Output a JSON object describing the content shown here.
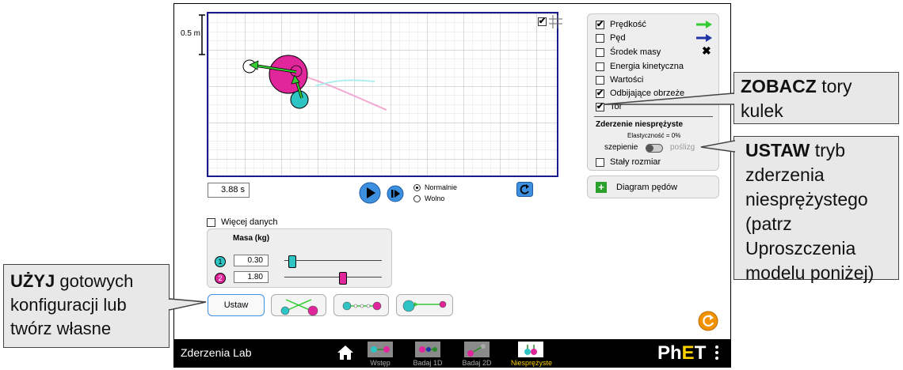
{
  "app": {
    "title": "Zderzenia Lab",
    "brand": "PhET"
  },
  "scale": {
    "label": "0.5 m"
  },
  "time": {
    "value": "3.88 s"
  },
  "speed_options": [
    {
      "label": "Normalnie",
      "selected": true
    },
    {
      "label": "Wolno",
      "selected": false
    }
  ],
  "options": [
    {
      "label": "Prędkość",
      "checked": true,
      "marker": "green-arrow"
    },
    {
      "label": "Pęd",
      "checked": false,
      "marker": "blue-arrow"
    },
    {
      "label": "Środek masy",
      "checked": false,
      "marker": "x-icon"
    },
    {
      "label": "Energia kinetyczna",
      "checked": false
    },
    {
      "label": "Wartości",
      "checked": false
    },
    {
      "label": "Odbijające obrzeże",
      "checked": true
    },
    {
      "label": "Tor",
      "checked": true
    }
  ],
  "collision": {
    "title": "Zderzenie niesprężyste",
    "elasticity": "Elastyczność = 0%",
    "left_label": "szepienie",
    "right_label": "poślizg",
    "stick": true
  },
  "constant_size": {
    "label": "Stały rozmiar",
    "checked": false
  },
  "momentum_diagram": {
    "label": "Diagram pędów"
  },
  "more_data": {
    "label": "Więcej danych",
    "checked": false
  },
  "mass_panel": {
    "title": "Masa (kg)",
    "balls": [
      {
        "number": "1",
        "value": "0.30",
        "color": "#2ec4c4",
        "fraction": 0.05
      },
      {
        "number": "2",
        "value": "1.80",
        "color": "#e0269a",
        "fraction": 0.58
      }
    ]
  },
  "config_buttons": {
    "custom_label": "Ustaw"
  },
  "tabs": [
    {
      "label": "Wstęp",
      "active": false
    },
    {
      "label": "Badaj 1D",
      "active": false
    },
    {
      "label": "Badaj 2D",
      "active": false
    },
    {
      "label": "Niesprężyste",
      "active": true
    }
  ],
  "callouts": {
    "see": {
      "bold": "ZOBACZ",
      "rest": " tory kulek"
    },
    "set": {
      "bold": "USTAW",
      "rest": " tryb zderzenia niesprężystego (patrz Uproszczenia modelu poniżej)"
    },
    "use": {
      "bold": "UŻYJ",
      "rest": " gotowych konfiguracji lub twórz własne"
    }
  },
  "colors": {
    "ball1": "#2ec4c4",
    "ball2": "#e0269a",
    "velocity": "#33cc33",
    "momentum": "#2233aa",
    "tab_active": "#ffd200",
    "reset": "#f39200"
  }
}
